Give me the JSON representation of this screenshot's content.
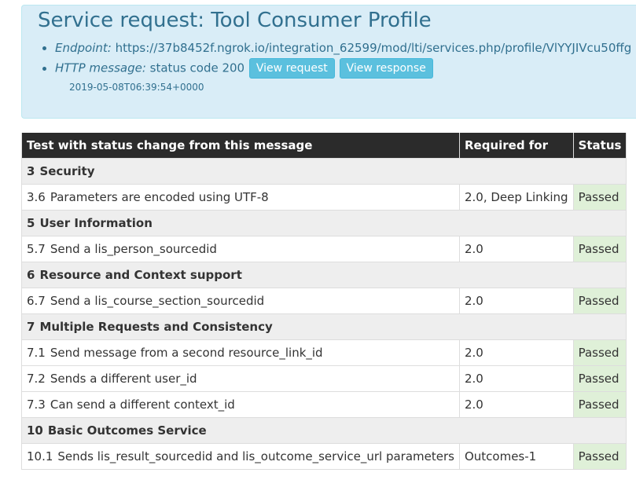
{
  "panel": {
    "title": "Service request: Tool Consumer Profile",
    "endpoint_label": "Endpoint:",
    "endpoint_value": "https://37b8452f.ngrok.io/integration_62599/mod/lti/services.php/profile/VlYYJIVcu50ffg",
    "http_label": "HTTP message:",
    "http_value": "status code 200",
    "view_request_label": "View request",
    "view_response_label": "View response",
    "timestamp": "2019-05-08T06:39:54+0000"
  },
  "table": {
    "headers": [
      "Test with status change from this message",
      "Required for",
      "Status"
    ],
    "rows": [
      {
        "type": "section",
        "num": "3",
        "label": "Security"
      },
      {
        "type": "test",
        "num": "3.6",
        "label": "Parameters are encoded using UTF-8",
        "required": "2.0, Deep Linking",
        "status": "Passed"
      },
      {
        "type": "section",
        "num": "5",
        "label": "User Information"
      },
      {
        "type": "test",
        "num": "5.7",
        "label": "Send a lis_person_sourcedid",
        "required": "2.0",
        "status": "Passed"
      },
      {
        "type": "section",
        "num": "6",
        "label": "Resource and Context support"
      },
      {
        "type": "test",
        "num": "6.7",
        "label": "Send a lis_course_section_sourcedid",
        "required": "2.0",
        "status": "Passed"
      },
      {
        "type": "section",
        "num": "7",
        "label": "Multiple Requests and Consistency"
      },
      {
        "type": "test",
        "num": "7.1",
        "label": "Send message from a second resource_link_id",
        "required": "2.0",
        "status": "Passed"
      },
      {
        "type": "test",
        "num": "7.2",
        "label": "Sends a different user_id",
        "required": "2.0",
        "status": "Passed"
      },
      {
        "type": "test",
        "num": "7.3",
        "label": "Can send a different context_id",
        "required": "2.0",
        "status": "Passed"
      },
      {
        "type": "section",
        "num": "10",
        "label": "Basic Outcomes Service"
      },
      {
        "type": "test",
        "num": "10.1",
        "label": "Sends lis_result_sourcedid and lis_outcome_service_url parameters",
        "required": "Outcomes-1",
        "status": "Passed"
      }
    ]
  },
  "colors": {
    "panel_bg": "#d9edf7",
    "panel_text": "#31708f",
    "button_bg": "#5bc0de",
    "header_bg": "#2b2b2b",
    "section_bg": "#eeeeee",
    "passed_bg": "#dff0d8"
  }
}
